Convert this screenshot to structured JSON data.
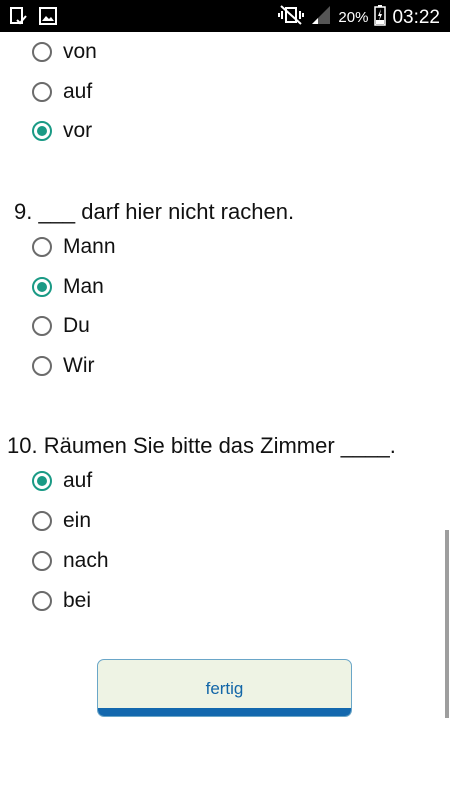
{
  "status_bar": {
    "battery_percent": "20%",
    "time": "03:22",
    "icons": [
      "clipboard-check-icon",
      "image-icon",
      "vibrate-mute-icon",
      "signal-icon",
      "battery-charging-icon"
    ]
  },
  "questions": [
    {
      "number_text": "",
      "options": [
        {
          "label": "von",
          "selected": false
        },
        {
          "label": "auf",
          "selected": false
        },
        {
          "label": "vor",
          "selected": true
        }
      ]
    },
    {
      "number_text": "9. ___ darf hier nicht rachen.",
      "options": [
        {
          "label": "Mann",
          "selected": false
        },
        {
          "label": "Man",
          "selected": true
        },
        {
          "label": "Du",
          "selected": false
        },
        {
          "label": "Wir",
          "selected": false
        }
      ]
    },
    {
      "number_text": "10. Räumen Sie bitte das Zimmer ____.",
      "options": [
        {
          "label": "auf",
          "selected": true
        },
        {
          "label": "ein",
          "selected": false
        },
        {
          "label": "nach",
          "selected": false
        },
        {
          "label": "bei",
          "selected": false
        }
      ]
    }
  ],
  "submit_button": {
    "label": "fertig"
  },
  "colors": {
    "radio_selected": "#1a9a85",
    "button_text": "#1266a8",
    "button_bar": "#1368ae"
  }
}
